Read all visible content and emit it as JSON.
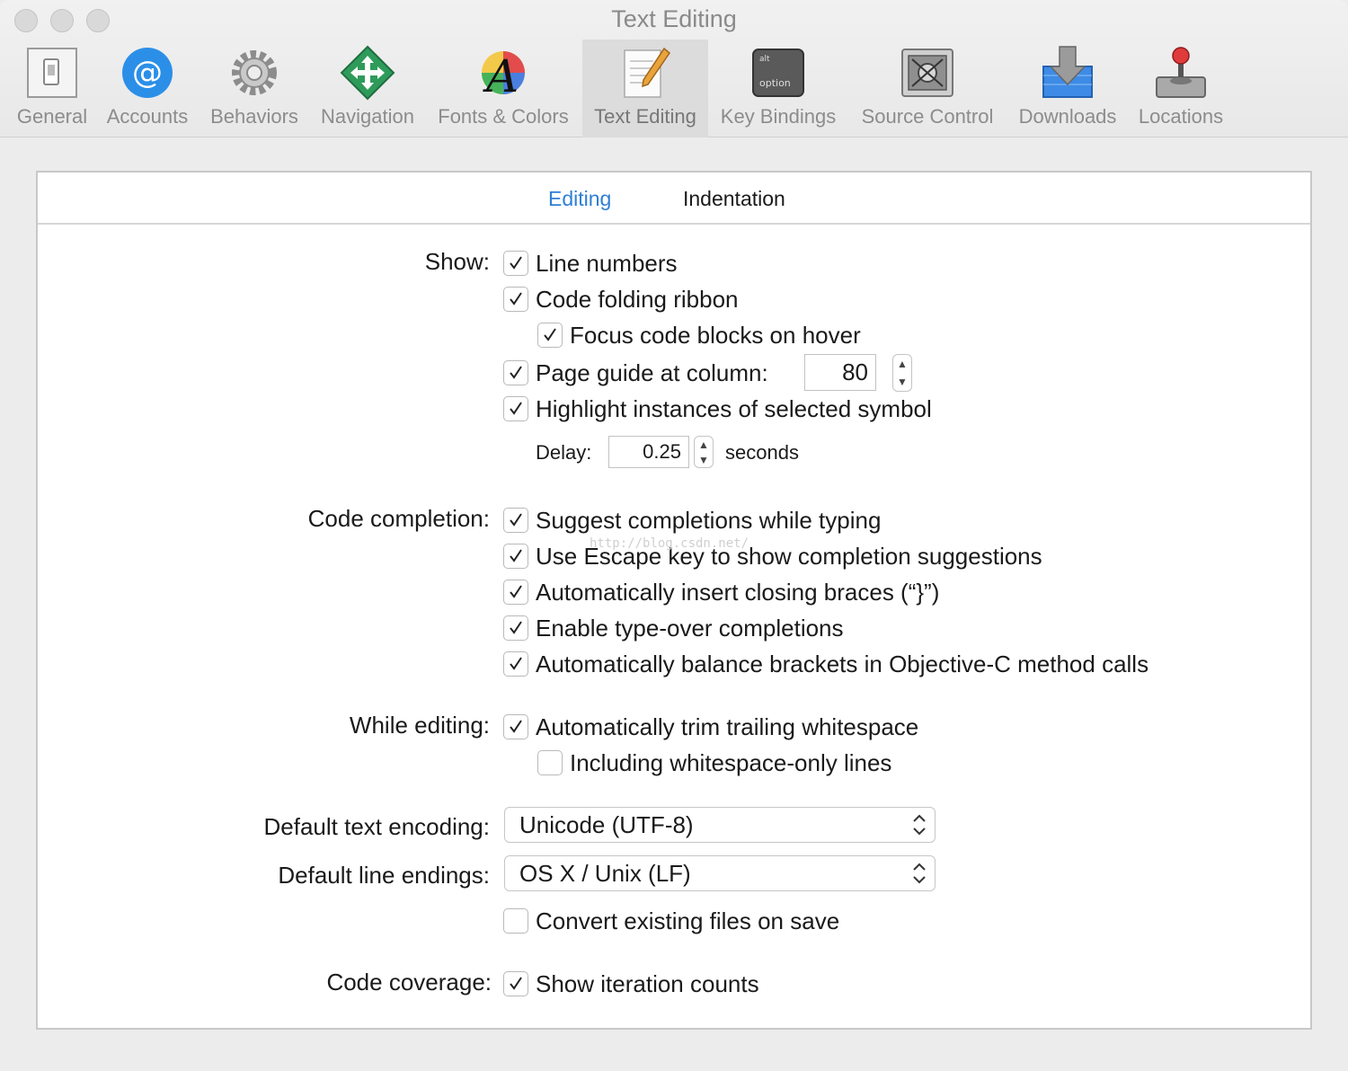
{
  "window": {
    "title": "Text Editing"
  },
  "toolbar": {
    "items": [
      {
        "label": "General",
        "icon": "general-switch-icon"
      },
      {
        "label": "Accounts",
        "icon": "at-sign-icon"
      },
      {
        "label": "Behaviors",
        "icon": "gear-icon"
      },
      {
        "label": "Navigation",
        "icon": "navigation-arrows-icon"
      },
      {
        "label": "Fonts & Colors",
        "icon": "font-color-icon"
      },
      {
        "label": "Text Editing",
        "icon": "pencil-paper-icon",
        "selected": true
      },
      {
        "label": "Key Bindings",
        "icon": "option-key-icon"
      },
      {
        "label": "Source Control",
        "icon": "vault-icon"
      },
      {
        "label": "Downloads",
        "icon": "download-arrow-icon"
      },
      {
        "label": "Locations",
        "icon": "joystick-disk-icon"
      }
    ]
  },
  "tabs": {
    "editing": "Editing",
    "indentation": "Indentation",
    "selected": "Editing"
  },
  "show": {
    "label": "Show:",
    "line_numbers": {
      "label": "Line numbers",
      "checked": true
    },
    "code_folding": {
      "label": "Code folding ribbon",
      "checked": true
    },
    "focus_blocks": {
      "label": "Focus code blocks on hover",
      "checked": true
    },
    "page_guide": {
      "label": "Page guide at column:",
      "checked": true,
      "value": "80"
    },
    "highlight": {
      "label": "Highlight instances of selected symbol",
      "checked": true
    },
    "delay": {
      "label": "Delay:",
      "value": "0.25",
      "unit": "seconds"
    }
  },
  "completion": {
    "label": "Code completion:",
    "suggest": {
      "label": "Suggest completions while typing",
      "checked": true
    },
    "escape": {
      "label": "Use Escape key to show completion suggestions",
      "checked": true
    },
    "braces": {
      "label": "Automatically insert closing braces (“}”)",
      "checked": true
    },
    "typeover": {
      "label": "Enable type-over completions",
      "checked": true
    },
    "balance": {
      "label": "Automatically balance brackets in Objective-C method calls",
      "checked": true
    }
  },
  "while_editing": {
    "label": "While editing:",
    "trim": {
      "label": "Automatically trim trailing whitespace",
      "checked": true
    },
    "whitespace_only": {
      "label": "Including whitespace-only lines",
      "checked": false
    }
  },
  "encoding": {
    "label": "Default text encoding:",
    "value": "Unicode (UTF-8)"
  },
  "line_endings": {
    "label": "Default line endings:",
    "value": "OS X / Unix (LF)"
  },
  "convert": {
    "label": "Convert existing files on save",
    "checked": false
  },
  "coverage": {
    "label": "Code coverage:",
    "iteration": {
      "label": "Show iteration counts",
      "checked": true
    }
  },
  "watermark": "http://blog.csdn.net/"
}
